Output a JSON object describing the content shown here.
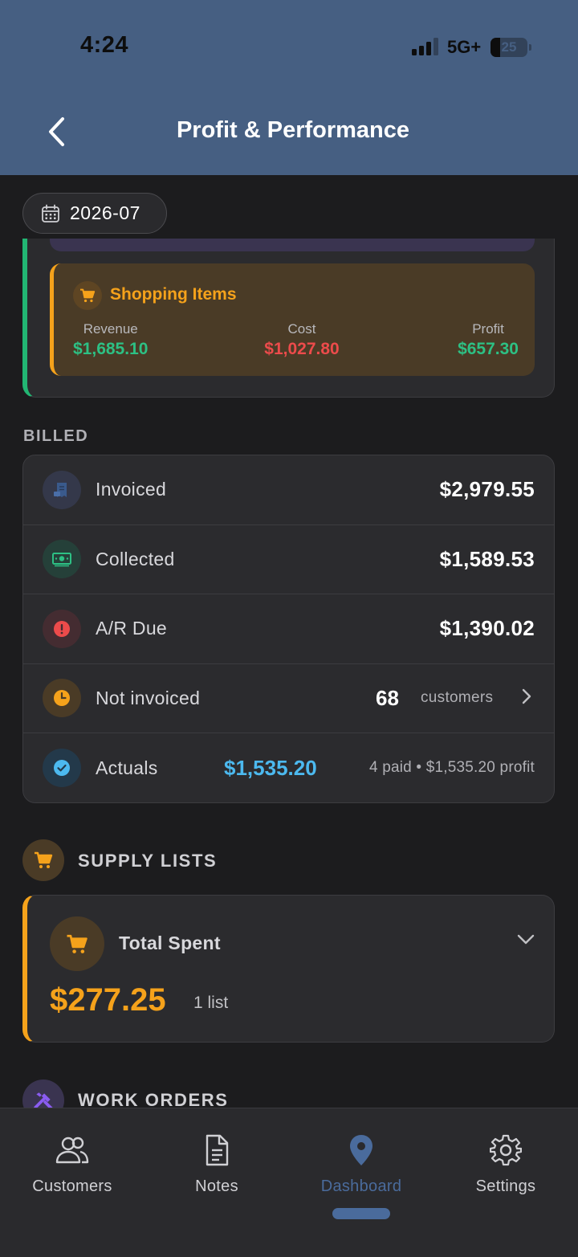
{
  "status_bar": {
    "time": "4:24",
    "network": "5G+",
    "battery": "25",
    "battery_level": 0.25
  },
  "header": {
    "title": "Profit & Performance"
  },
  "date_filter": {
    "value": "2026-07"
  },
  "shopping_items": {
    "title": "Shopping Items",
    "revenue_label": "Revenue",
    "revenue_value": "$1,685.10",
    "cost_label": "Cost",
    "cost_value": "$1,027.80",
    "profit_label": "Profit",
    "profit_value": "$657.30"
  },
  "billed": {
    "section_label": "BILLED",
    "rows": [
      {
        "label": "Invoiced",
        "value": "$2,979.55"
      },
      {
        "label": "Collected",
        "value": "$1,589.53"
      },
      {
        "label": "A/R Due",
        "value": "$1,390.02"
      },
      {
        "label": "Not invoiced",
        "count": "68",
        "unit": "customers"
      },
      {
        "label": "Actuals",
        "value": "$1,535.20",
        "meta": "4 paid • $1,535.20 profit"
      }
    ]
  },
  "supply_lists": {
    "section_label": "SUPPLY LISTS",
    "card_title": "Total Spent",
    "amount": "$277.25",
    "count": "1 list"
  },
  "work_orders": {
    "section_label": "WORK ORDERS"
  },
  "bottom_nav": {
    "items": [
      {
        "label": "Customers",
        "icon": "users-icon"
      },
      {
        "label": "Notes",
        "icon": "document-icon"
      },
      {
        "label": "Dashboard",
        "icon": "map-pin-icon",
        "active": true
      },
      {
        "label": "Settings",
        "icon": "gear-icon"
      }
    ]
  },
  "colors": {
    "header_bg": "#465f82",
    "accent_green": "#2dc084",
    "accent_red": "#ec4b4b",
    "accent_orange": "#f5a21b",
    "accent_blue": "#4cb9ef",
    "active_nav": "#4a6b9c"
  }
}
